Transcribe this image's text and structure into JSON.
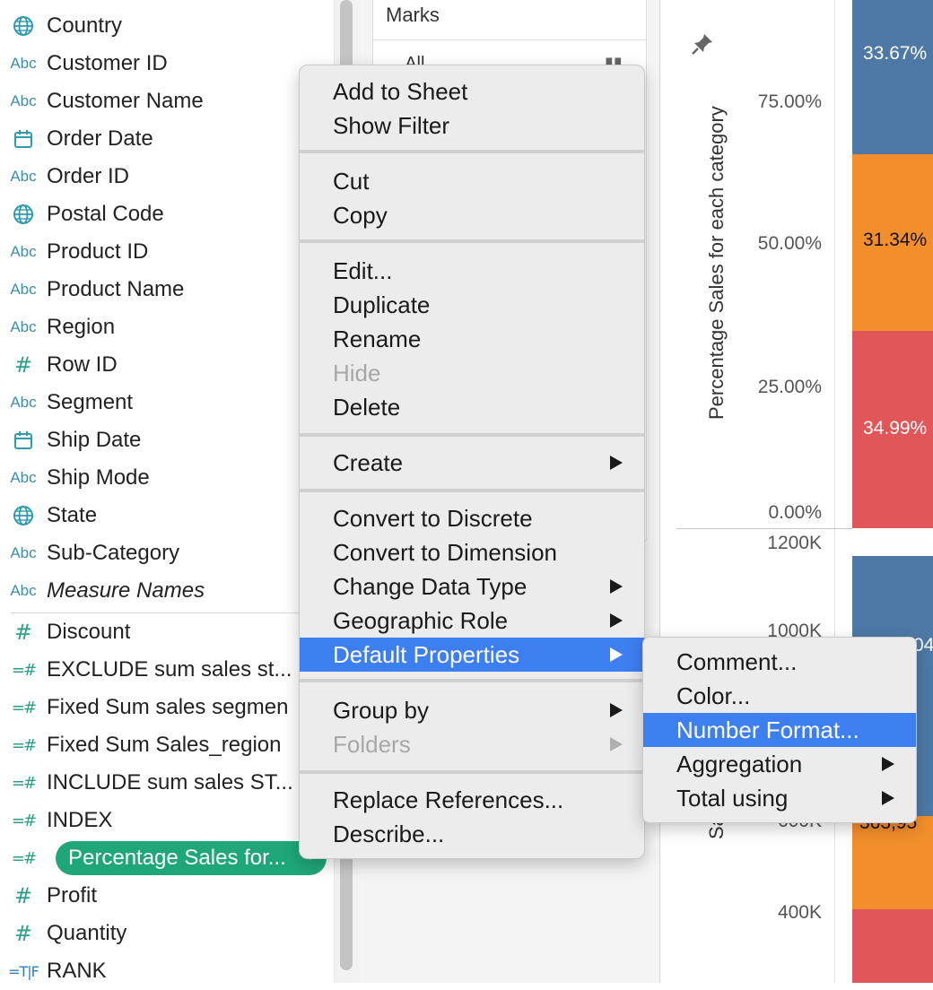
{
  "data_pane": {
    "fields": [
      {
        "icon": "globe",
        "name": "Country"
      },
      {
        "icon": "abc",
        "name": "Customer ID"
      },
      {
        "icon": "abc",
        "name": "Customer Name"
      },
      {
        "icon": "calendar",
        "name": "Order Date"
      },
      {
        "icon": "abc",
        "name": "Order ID"
      },
      {
        "icon": "globe",
        "name": "Postal Code"
      },
      {
        "icon": "abc",
        "name": "Product ID"
      },
      {
        "icon": "abc",
        "name": "Product Name"
      },
      {
        "icon": "abc",
        "name": "Region"
      },
      {
        "icon": "hash",
        "name": "Row ID"
      },
      {
        "icon": "abc",
        "name": "Segment"
      },
      {
        "icon": "calendar",
        "name": "Ship Date"
      },
      {
        "icon": "abc",
        "name": "Ship Mode"
      },
      {
        "icon": "globe",
        "name": "State"
      },
      {
        "icon": "abc",
        "name": "Sub-Category"
      },
      {
        "icon": "abc",
        "name": "Measure Names"
      }
    ],
    "measures": [
      {
        "icon": "hash",
        "name": "Discount"
      },
      {
        "icon": "calc",
        "name": "EXCLUDE sum sales st..."
      },
      {
        "icon": "calc",
        "name": "Fixed Sum sales segmen"
      },
      {
        "icon": "calc",
        "name": "Fixed Sum Sales_region"
      },
      {
        "icon": "calc",
        "name": "INCLUDE sum sales ST..."
      },
      {
        "icon": "calc",
        "name": "INDEX"
      },
      {
        "icon": "calc",
        "name": "Percentage Sales for..."
      },
      {
        "icon": "hash",
        "name": "Profit"
      },
      {
        "icon": "hash",
        "name": "Quantity"
      },
      {
        "icon": "bool",
        "name": "RANK"
      }
    ],
    "icon_glyphs": {
      "abc": "Abc",
      "hash": "#",
      "calc": "=#",
      "bool": "=T|F"
    }
  },
  "marks_card": {
    "title": "Marks",
    "all_label": "All"
  },
  "chart": {
    "y_title_top": "Percentage Sales for each category",
    "y_title_bottom": "Sa",
    "top_ticks": [
      "75.00%",
      "50.00%",
      "25.00%",
      "0.00%"
    ],
    "bottom_ticks": [
      "1200K",
      "1000K",
      "600K",
      "400K"
    ],
    "top_labels": [
      "33.67%",
      "31.34%",
      "34.99%"
    ],
    "bottom_labels": [
      "04",
      "363,95"
    ],
    "colors": {
      "blue": "#4e79a7",
      "orange": "#f28e2b",
      "red": "#e15759"
    }
  },
  "chart_data": {
    "type": "bar",
    "title": "",
    "ylabel": "Percentage Sales for each category",
    "ylim": [
      0,
      1
    ],
    "series": [
      {
        "name": "",
        "values": [
          0.3367
        ],
        "color": "#4e79a7"
      },
      {
        "name": "",
        "values": [
          0.3134
        ],
        "color": "#f28e2b"
      },
      {
        "name": "",
        "values": [
          0.3499
        ],
        "color": "#e15759"
      }
    ]
  },
  "context_menu": {
    "g1": [
      "Add to Sheet",
      "Show Filter"
    ],
    "g2": [
      "Cut",
      "Copy"
    ],
    "g3": [
      "Edit...",
      "Duplicate",
      "Rename",
      "Hide",
      "Delete"
    ],
    "g4": [
      "Create"
    ],
    "g5": [
      "Convert to Discrete",
      "Convert to Dimension",
      "Change Data Type",
      "Geographic Role",
      "Default Properties"
    ],
    "g6": [
      "Group by",
      "Folders"
    ],
    "g7": [
      "Replace References...",
      "Describe..."
    ]
  },
  "submenu": [
    "Comment...",
    "Color...",
    "Number Format...",
    "Aggregation",
    "Total using"
  ]
}
